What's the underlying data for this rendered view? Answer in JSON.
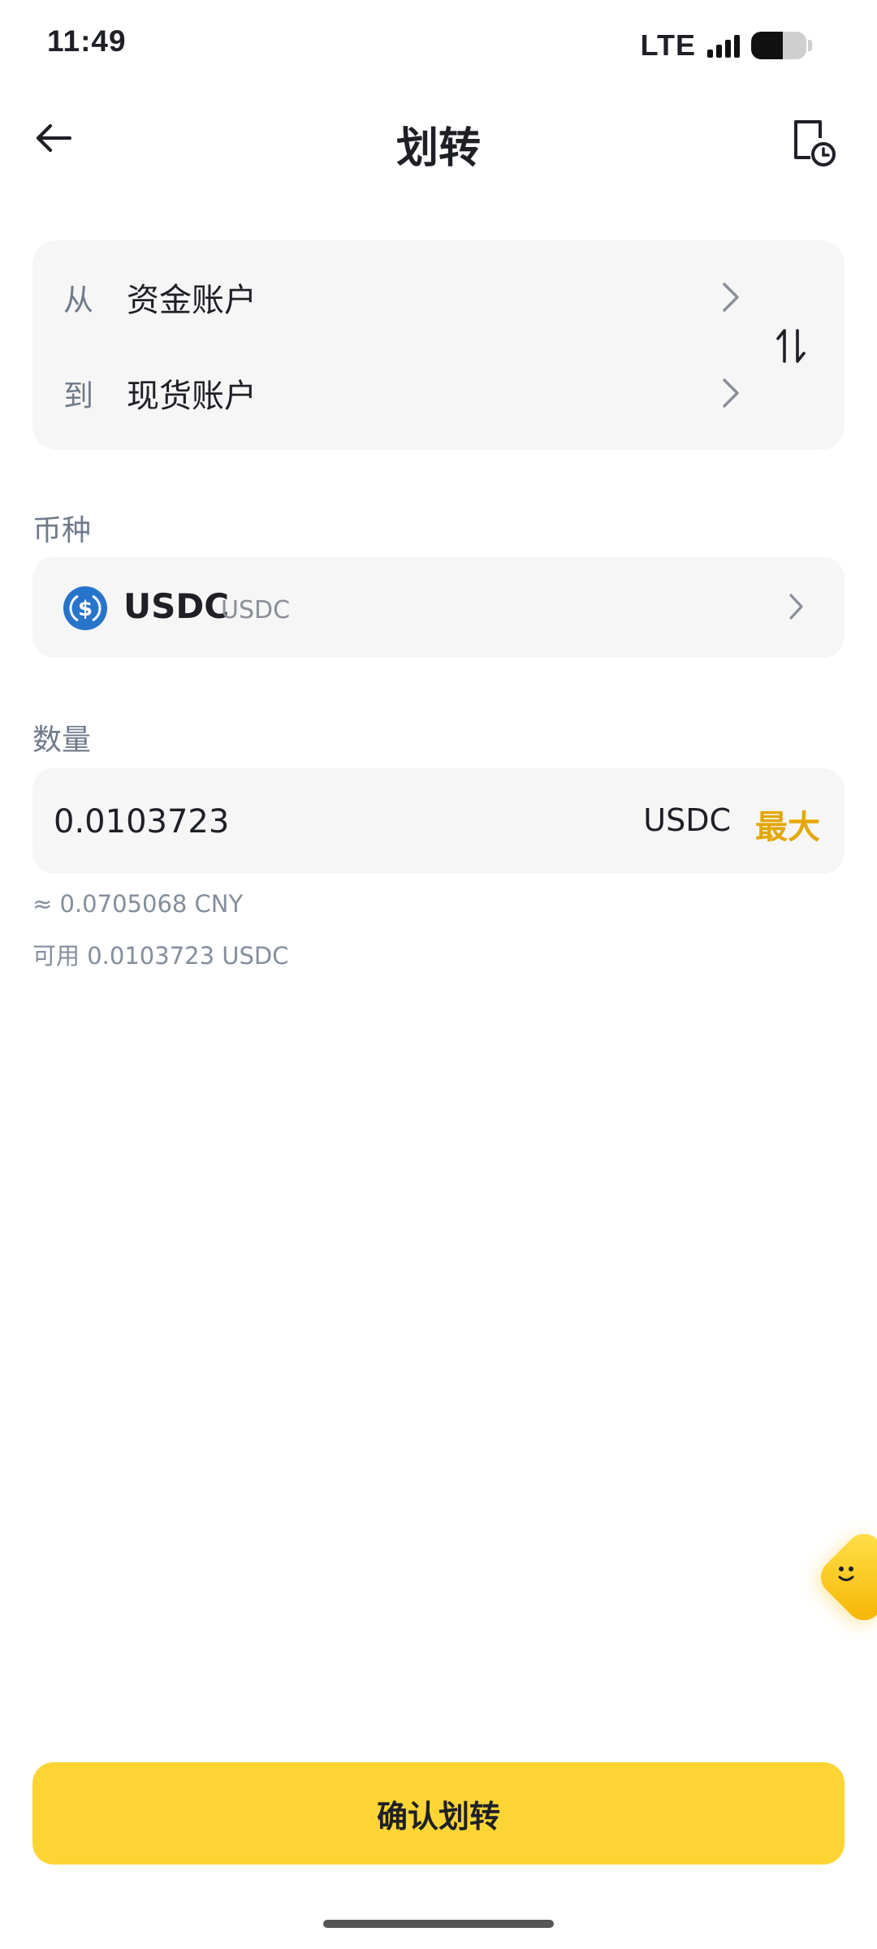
{
  "status_bar": {
    "time": "11:49",
    "network": "LTE"
  },
  "header": {
    "title": "划转",
    "back_icon": "arrow-left-icon",
    "history_icon": "transfer-history-icon"
  },
  "transfer": {
    "from_label": "从",
    "from_account": "资金账户",
    "to_label": "到",
    "to_account": "现货账户",
    "swap_icon": "swap-vertical-icon"
  },
  "coin": {
    "section_label": "币种",
    "name": "USDC",
    "subtitle": "USDC",
    "icon": "usdc-coin-icon"
  },
  "amount": {
    "section_label": "数量",
    "value": "0.0103723",
    "unit": "USDC",
    "max_label": "最大",
    "approx_value": "≈ 0.0705068 CNY",
    "available_label": "可用",
    "available_value": "0.0103723 USDC"
  },
  "confirm": {
    "label": "确认划转"
  },
  "colors": {
    "brand_yellow": "#FCD535",
    "max_text": "#E3A707",
    "card_bg": "#F6F6F6",
    "usdc_blue": "#2775CA"
  }
}
